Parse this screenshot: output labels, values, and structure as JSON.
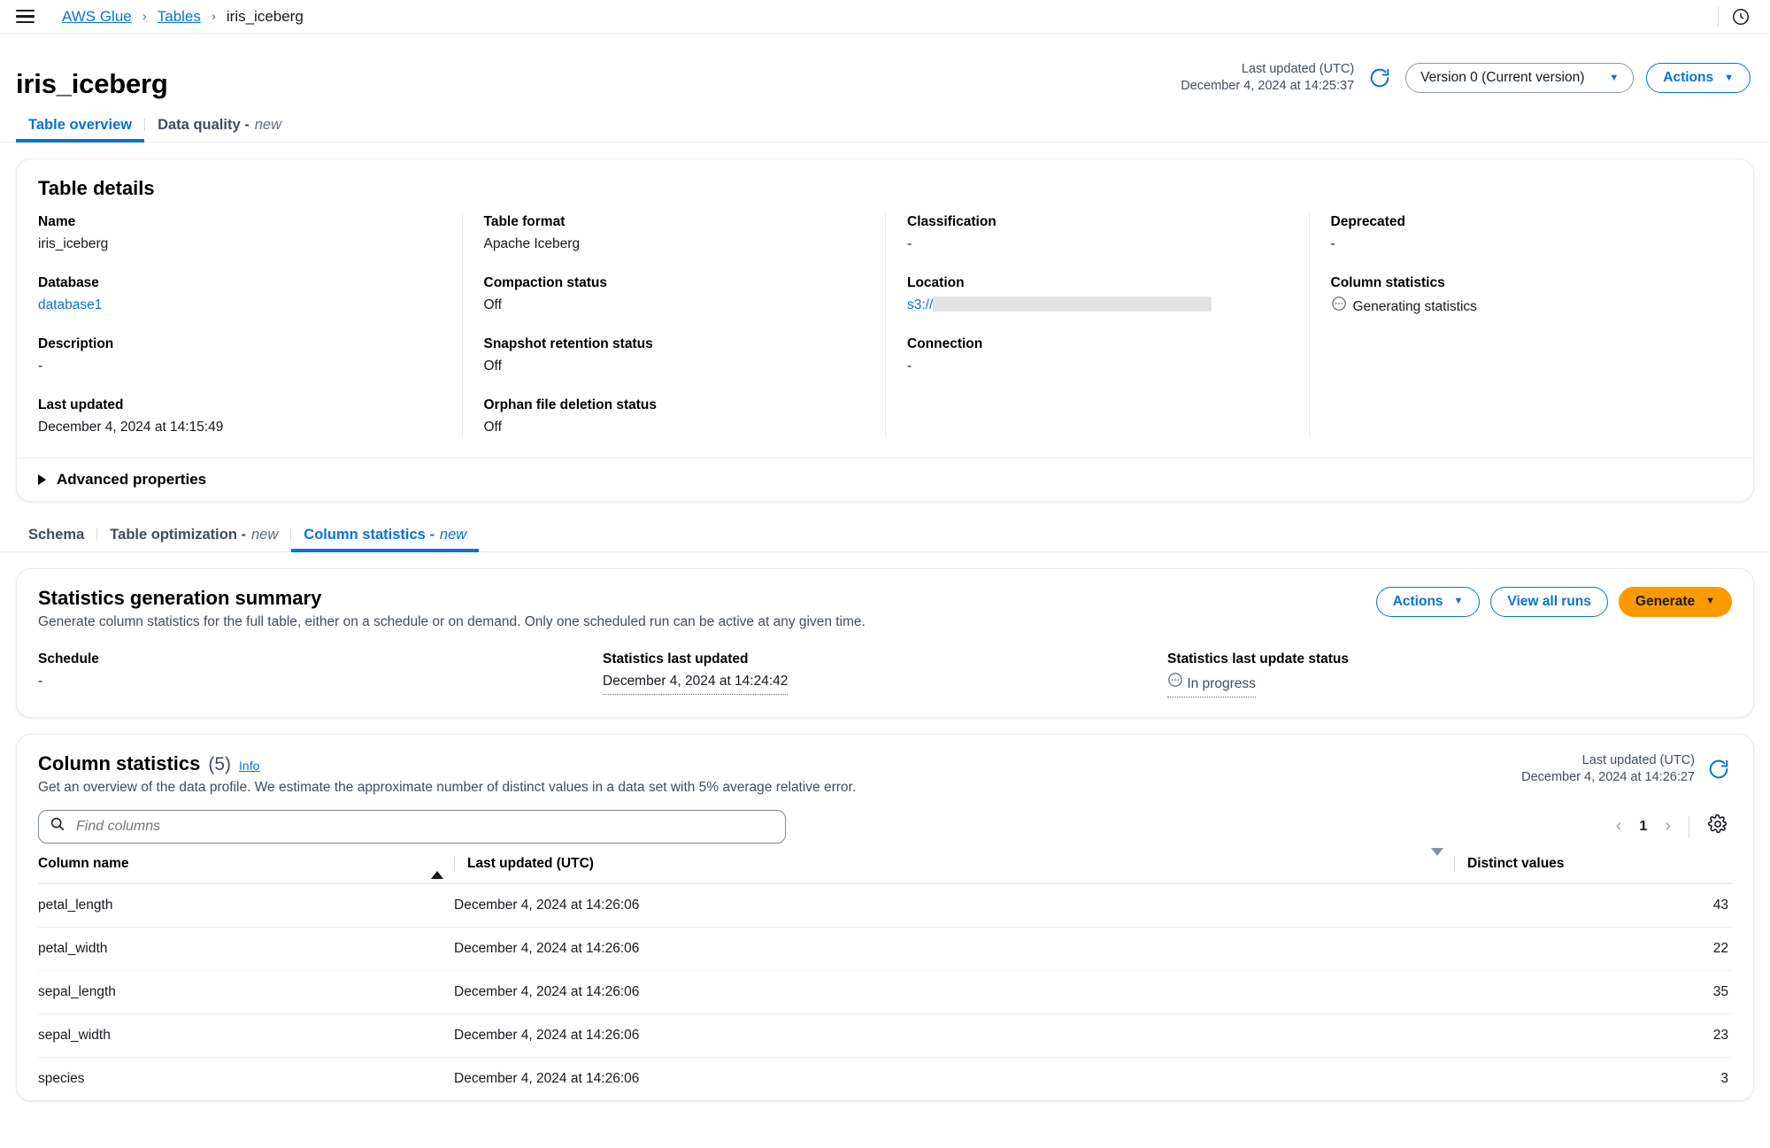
{
  "topbar": {
    "menu_icon": "hamburger-menu-icon",
    "breadcrumb": [
      {
        "label": "AWS Glue",
        "link": true
      },
      {
        "label": "Tables",
        "link": true
      },
      {
        "label": "iris_iceberg",
        "link": false
      }
    ],
    "separator": "›",
    "notification_icon": "recent-activity-clock-icon"
  },
  "header": {
    "title": "iris_iceberg",
    "last_updated_label": "Last updated (UTC)",
    "last_updated_value": "December 4, 2024 at 14:25:37",
    "refresh_icon": "refresh-icon",
    "version_select": "Version 0 (Current version)",
    "actions_button": "Actions",
    "caret": "▼"
  },
  "main_tabs": [
    {
      "label": "Table overview",
      "new": "",
      "active": true
    },
    {
      "label": "Data quality -",
      "new": "new",
      "active": false
    }
  ],
  "table_details": {
    "title": "Table details",
    "columns": [
      [
        {
          "label": "Name",
          "value": "iris_iceberg",
          "link": false
        },
        {
          "label": "Database",
          "value": "database1",
          "link": true
        },
        {
          "label": "Description",
          "value": "-",
          "link": false
        },
        {
          "label": "Last updated",
          "value": "December 4, 2024 at 14:15:49",
          "link": false
        }
      ],
      [
        {
          "label": "Table format",
          "value": "Apache Iceberg",
          "link": false
        },
        {
          "label": "Compaction status",
          "value": "Off",
          "link": false
        },
        {
          "label": "Snapshot retention status",
          "value": "Off",
          "link": false
        },
        {
          "label": "Orphan file deletion status",
          "value": "Off",
          "link": false
        }
      ],
      [
        {
          "label": "Classification",
          "value": "-",
          "link": false
        },
        {
          "label": "Location",
          "value": "s3://",
          "link": true,
          "redacted": true
        },
        {
          "label": "Connection",
          "value": "-",
          "link": false
        }
      ],
      [
        {
          "label": "Deprecated",
          "value": "-",
          "link": false
        },
        {
          "label": "Column statistics",
          "value": "Generating statistics",
          "status": "pending"
        }
      ]
    ],
    "advanced_properties": "Advanced properties"
  },
  "section_tabs": [
    {
      "label": "Schema",
      "new": "",
      "active": false
    },
    {
      "label": "Table optimization -",
      "new": "new",
      "active": false
    },
    {
      "label": "Column statistics -",
      "new": "new",
      "active": true
    }
  ],
  "summary": {
    "title": "Statistics generation summary",
    "description": "Generate column statistics for the full table, either on a schedule or on demand. Only one scheduled run can be active at any given time.",
    "actions_button": "Actions",
    "view_all_runs_button": "View all runs",
    "generate_button": "Generate",
    "fields": [
      {
        "label": "Schedule",
        "value": "-",
        "dotted": false,
        "status": ""
      },
      {
        "label": "Statistics last updated",
        "value": "December 4, 2024 at 14:24:42",
        "dotted": true,
        "status": ""
      },
      {
        "label": "Statistics last update status",
        "value": "In progress",
        "dotted": true,
        "status": "pending"
      }
    ]
  },
  "column_statistics": {
    "title": "Column statistics",
    "count": "(5)",
    "info_link": "Info",
    "description": "Get an overview of the data profile. We estimate the approximate number of distinct values in a data set with 5% average relative error.",
    "last_updated_label": "Last updated (UTC)",
    "last_updated_value": "December 4, 2024 at 14:26:27",
    "refresh_icon": "refresh-icon",
    "search_placeholder": "Find columns",
    "search_value": "",
    "search_icon": "search-icon",
    "pagination": {
      "prev": "‹",
      "page": "1",
      "next": "›"
    },
    "settings_icon": "gear-icon",
    "headers": [
      {
        "label": "Column name",
        "sort": "asc"
      },
      {
        "label": "Last updated (UTC)",
        "sort": "desc-inactive"
      },
      {
        "label": "Distinct values",
        "sort": "none"
      }
    ],
    "rows": [
      {
        "name": "petal_length",
        "updated": "December 4, 2024 at 14:26:06",
        "distinct": "43"
      },
      {
        "name": "petal_width",
        "updated": "December 4, 2024 at 14:26:06",
        "distinct": "22"
      },
      {
        "name": "sepal_length",
        "updated": "December 4, 2024 at 14:26:06",
        "distinct": "35"
      },
      {
        "name": "sepal_width",
        "updated": "December 4, 2024 at 14:26:06",
        "distinct": "23"
      },
      {
        "name": "species",
        "updated": "December 4, 2024 at 14:26:06",
        "distinct": "3"
      }
    ]
  },
  "colors": {
    "link": "#0972d3",
    "accent_orange": "#ff9900",
    "text": "#16191f",
    "muted": "#5f6b7a",
    "border": "#e9ebed"
  }
}
